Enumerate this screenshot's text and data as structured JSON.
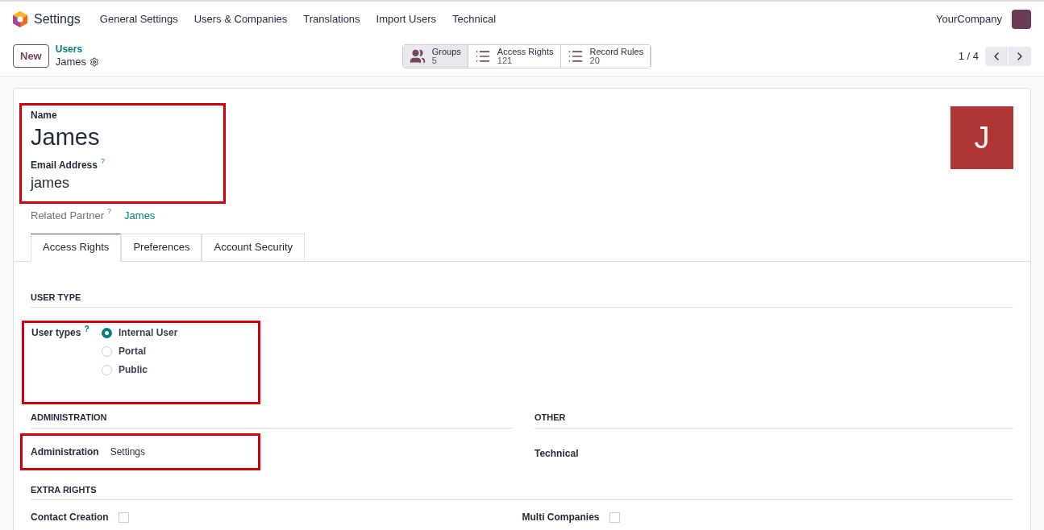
{
  "navbar": {
    "app": "Settings",
    "menu": [
      "General Settings",
      "Users & Companies",
      "Translations",
      "Import Users",
      "Technical"
    ],
    "company": "YourCompany"
  },
  "control_panel": {
    "new_button": "New",
    "breadcrumb": "Users",
    "record": "James",
    "smart_buttons": [
      {
        "kind": "groups",
        "label": "Groups",
        "count": "5",
        "selected": true
      },
      {
        "kind": "list",
        "label": "Access Rights",
        "count": "121",
        "selected": false
      },
      {
        "kind": "rules",
        "label": "Record Rules",
        "count": "20",
        "selected": false
      }
    ],
    "pager": "1 / 4"
  },
  "form": {
    "highlighted": true,
    "name_label": "Name",
    "name": "James",
    "email_label": "Email Address",
    "email_help": "?",
    "email": "james",
    "avatar_letter": "J",
    "partner_label": "Related Partner",
    "partner_help": "?",
    "partner": "James",
    "tabs": [
      {
        "label": "Access Rights",
        "selected": true
      },
      {
        "label": "Preferences",
        "selected": false
      },
      {
        "label": "Account Security",
        "selected": false
      }
    ],
    "user_type": {
      "heading": "USER TYPE",
      "highlighted": true,
      "label": "User types",
      "help": "?",
      "options": [
        {
          "label": "Internal User",
          "selected": true
        },
        {
          "label": "Portal",
          "selected": false
        },
        {
          "label": "Public",
          "selected": false
        }
      ]
    },
    "administration": {
      "heading": "ADMINISTRATION",
      "highlighted": true,
      "label": "Administration",
      "value": "Settings"
    },
    "other": {
      "heading": "OTHER",
      "label": "Technical"
    },
    "extra_rights": {
      "heading": "EXTRA RIGHTS",
      "items": [
        {
          "label": "Contact Creation",
          "checked": false
        },
        {
          "label": "Multi Companies",
          "checked": false
        }
      ]
    }
  }
}
